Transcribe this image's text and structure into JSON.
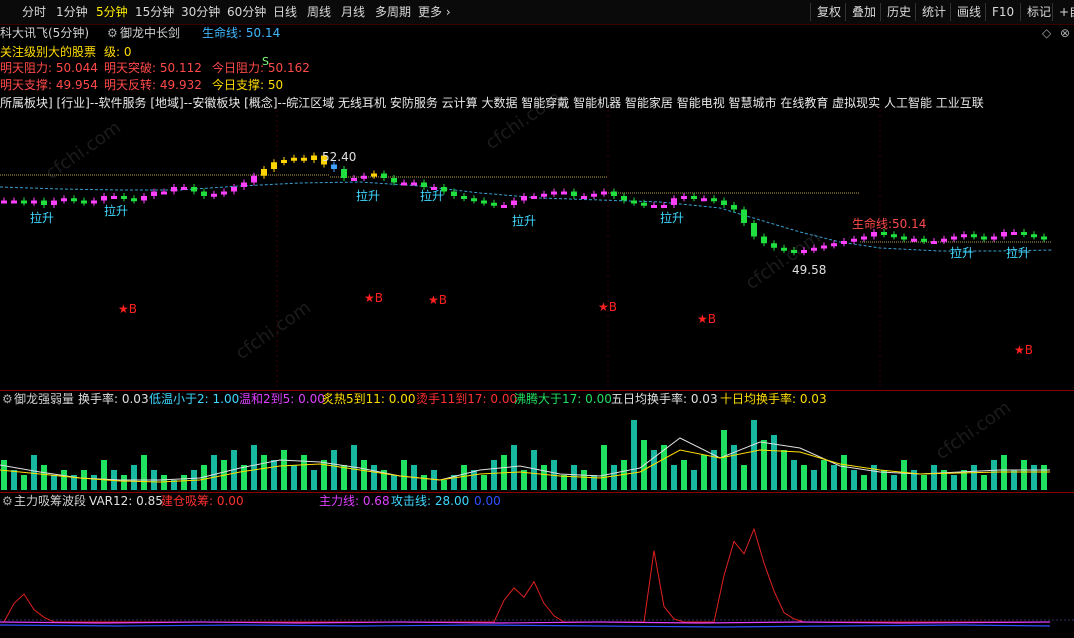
{
  "toolbar": {
    "periods": [
      "分时",
      "1分钟",
      "5分钟",
      "15分钟",
      "30分钟",
      "60分钟",
      "日线",
      "周线",
      "月线",
      "多周期",
      "更多 ›"
    ],
    "active_period": "5分钟",
    "right_buttons": [
      "复权",
      "叠加",
      "历史",
      "统计",
      "画线",
      "F10",
      "标记",
      "+自"
    ]
  },
  "header": {
    "stock_name": "科大讯飞(5分钟)",
    "indicator_name": "御龙中长剑",
    "lifeline_label": "生命线: 50.14"
  },
  "info": {
    "attention_label": "关注级别大的股票",
    "level_label": "级: 0",
    "tomorrow_resist": "明天阻力: 50.044",
    "tomorrow_break": "明天突破: 50.112",
    "today_resist": "今日阻力: 50.162",
    "tomorrow_support": "明天支撑: 49.954",
    "tomorrow_rebound": "明天反转: 49.932",
    "today_support": "今日支撑: 50",
    "sectors": "所属板块]   [行业]--软件服务      [地域]--安徽板块      [概念]--皖江区域 无线耳机 安防服务 云计算 大数据 智能穿戴 智能机器 智能家居 智能电视 智慧城市 在线教育 虚拟现实 人工智能 工业互联"
  },
  "main_chart": {
    "high_label": "52.40",
    "low_label": "49.58",
    "lifeline_text": "生命线:50.14",
    "rise_label": "拉升",
    "buy_label": "★B",
    "marker_s": "S"
  },
  "volume_panel": {
    "title": "御龙强弱量",
    "turnover": "换手率: 0.03",
    "low_temp": "低温小于2: 1.00",
    "mild": "温和2到5: 0.00",
    "hot": "炙热5到11: 0.00",
    "scald": "烫手11到17: 0.00",
    "boiling": "沸腾大于17: 0.00",
    "avg5": "五日均换手率: 0.03",
    "avg10": "十日均换手率: 0.03"
  },
  "flow_panel": {
    "title": "主力吸筹波段",
    "var12": "VAR12: 0.85",
    "build": "建仓吸筹: 0.00",
    "main_line": "主力线: 0.68",
    "attack_line": "攻击线: 28.00",
    "extra": "0.00"
  },
  "chart_data": {
    "type": "candlestick",
    "price_labels": {
      "high": 52.4,
      "low": 49.58,
      "lifeline": 50.14
    },
    "candles": [
      50.9,
      50.9,
      50.85,
      50.9,
      50.8,
      50.9,
      50.95,
      50.9,
      50.85,
      50.9,
      51.0,
      51.0,
      50.95,
      50.9,
      51.0,
      51.1,
      51.1,
      51.2,
      51.2,
      51.1,
      51.0,
      51.05,
      51.1,
      51.2,
      51.3,
      51.45,
      51.6,
      51.75,
      51.8,
      51.85,
      51.8,
      51.9,
      51.7,
      51.6,
      51.4,
      51.4,
      51.45,
      51.5,
      51.4,
      51.3,
      51.3,
      51.3,
      51.2,
      51.2,
      51.1,
      51.0,
      50.95,
      50.9,
      50.85,
      50.8,
      50.8,
      50.9,
      51.0,
      51.0,
      51.05,
      51.1,
      51.1,
      51.0,
      51.0,
      51.05,
      51.1,
      51.0,
      50.9,
      50.85,
      50.8,
      50.8,
      50.8,
      50.95,
      51.0,
      50.95,
      50.95,
      50.9,
      50.8,
      50.7,
      50.4,
      50.1,
      49.95,
      49.85,
      49.8,
      49.75,
      49.8,
      49.85,
      49.9,
      49.95,
      50.0,
      50.05,
      50.1,
      50.2,
      50.15,
      50.1,
      50.05,
      50.05,
      50.0,
      50.0,
      50.05,
      50.1,
      50.15,
      50.1,
      50.05,
      50.1,
      50.2,
      50.2,
      50.15,
      50.1,
      50.05
    ],
    "volume": [
      6,
      4,
      3,
      7,
      5,
      3,
      4,
      3,
      4,
      3,
      6,
      4,
      3,
      5,
      7,
      4,
      3,
      2,
      3,
      4,
      5,
      7,
      6,
      8,
      5,
      9,
      7,
      6,
      8,
      5,
      7,
      4,
      6,
      8,
      5,
      9,
      6,
      5,
      4,
      3,
      6,
      5,
      3,
      4,
      2,
      3,
      5,
      4,
      3,
      6,
      7,
      9,
      4,
      8,
      5,
      6,
      3,
      5,
      4,
      3,
      9,
      5,
      6,
      14,
      10,
      8,
      9,
      5,
      6,
      4,
      7,
      8,
      12,
      9,
      5,
      14,
      10,
      11,
      8,
      6,
      5,
      4,
      6,
      5,
      7,
      4,
      3,
      5,
      4,
      3,
      6,
      4,
      3,
      5,
      4,
      3,
      4,
      5,
      3,
      6,
      7,
      4,
      6,
      5,
      5
    ],
    "flow": [
      0,
      12,
      18,
      8,
      3,
      0,
      0,
      0,
      0,
      0,
      0,
      0,
      0,
      0,
      0,
      0,
      0,
      0,
      0,
      0,
      0,
      0,
      0,
      0,
      0,
      0,
      0,
      0,
      0,
      0,
      0,
      0,
      0,
      0,
      0,
      0,
      0,
      0,
      0,
      0,
      0,
      0,
      0,
      0,
      0,
      0,
      0,
      0,
      0,
      0,
      14,
      22,
      16,
      26,
      12,
      4,
      0,
      0,
      0,
      0,
      0,
      0,
      0,
      0,
      0,
      46,
      10,
      2,
      0,
      0,
      0,
      0,
      30,
      52,
      44,
      60,
      38,
      20,
      6,
      2,
      0,
      0,
      0,
      0,
      0,
      0,
      0,
      0,
      0,
      0,
      0,
      0,
      0,
      0,
      0,
      0,
      0,
      0,
      0,
      0,
      0,
      0,
      0,
      0,
      0
    ]
  }
}
